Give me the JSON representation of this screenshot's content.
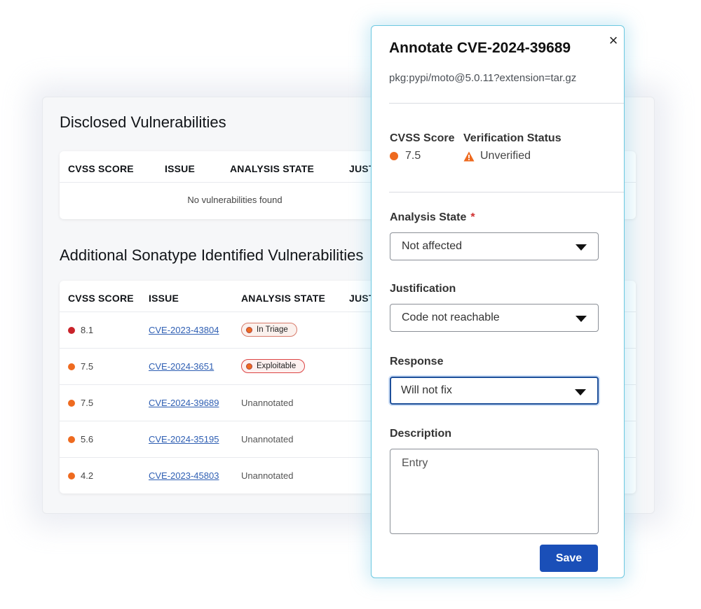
{
  "colors": {
    "critical": "#c9232a",
    "high": "#ee6a1f",
    "medium": "#ee6a1f",
    "accent": "#1a4fb8",
    "modal_border": "#6cc8e0"
  },
  "disclosed": {
    "title": "Disclosed Vulnerabilities",
    "columns": [
      "CVSS SCORE",
      "ISSUE",
      "ANALYSIS STATE",
      "JUST"
    ],
    "empty_message": "No vulnerabilities found"
  },
  "additional": {
    "title": "Additional Sonatype Identified Vulnerabilities",
    "columns": [
      "CVSS SCORE",
      "ISSUE",
      "ANALYSIS STATE",
      "JUST"
    ],
    "rows": [
      {
        "score": "8.1",
        "severity": "critical",
        "issue": "CVE-2023-43804",
        "state": "In Triage",
        "state_type": "pill-triage"
      },
      {
        "score": "7.5",
        "severity": "high",
        "issue": "CVE-2024-3651",
        "state": "Exploitable",
        "state_type": "pill-exploitable"
      },
      {
        "score": "7.5",
        "severity": "high",
        "issue": "CVE-2024-39689",
        "state": "Unannotated",
        "state_type": "text"
      },
      {
        "score": "5.6",
        "severity": "medium",
        "issue": "CVE-2024-35195",
        "state": "Unannotated",
        "state_type": "text"
      },
      {
        "score": "4.2",
        "severity": "medium",
        "issue": "CVE-2023-45803",
        "state": "Unannotated",
        "state_type": "text"
      }
    ]
  },
  "modal": {
    "title": "Annotate CVE-2024-39689",
    "close_icon": "×",
    "package": "pkg:pypi/moto@5.0.11?extension=tar.gz",
    "cvss_label": "CVSS Score",
    "cvss_value": "7.5",
    "verification_label": "Verification Status",
    "verification_value": "Unverified",
    "analysis_state_label": "Analysis State",
    "required_marker": "*",
    "analysis_state_value": "Not affected",
    "justification_label": "Justification",
    "justification_value": "Code not reachable",
    "response_label": "Response",
    "response_value": "Will not fix",
    "description_label": "Description",
    "description_placeholder": "Entry",
    "save_label": "Save"
  }
}
